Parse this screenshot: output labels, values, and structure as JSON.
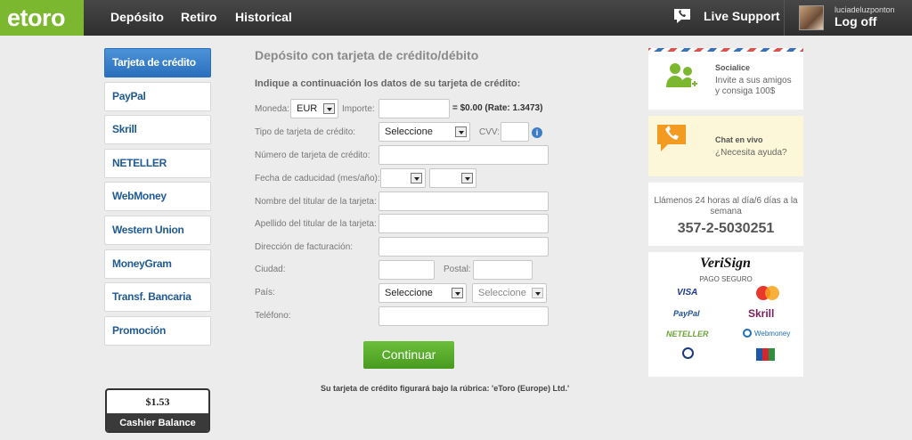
{
  "header": {
    "logo": "etoro",
    "nav": [
      "Depósito",
      "Retiro",
      "Historical"
    ],
    "live_support": "Live Support",
    "username": "luciadeluzponton",
    "logoff": "Log off"
  },
  "sidebar": {
    "items": [
      {
        "label": "Tarjeta de crédito",
        "active": true
      },
      {
        "label": "PayPal"
      },
      {
        "label": "Skrill"
      },
      {
        "label": "NETELLER"
      },
      {
        "label": "WebMoney"
      },
      {
        "label": "Western Union"
      },
      {
        "label": "MoneyGram"
      },
      {
        "label": "Transf. Bancaria"
      },
      {
        "label": "Promoción"
      }
    ],
    "cashier_amount": "$1.53",
    "cashier_label": "Cashier Balance"
  },
  "form": {
    "title": "Depósito con tarjeta de crédito/débito",
    "subtitle": "Indique a continuación los datos de su tarjeta de crédito:",
    "moneda_label": "Moneda:",
    "moneda_value": "EUR",
    "importe_label": "Importe:",
    "importe_value": "",
    "rate_text": "= $0.00 (Rate: 1.3473)",
    "tipo_label": "Tipo de tarjeta de crédito:",
    "tipo_value": "Seleccione",
    "cvv_label": "CVV:",
    "numero_label": "Número de tarjeta de crédito:",
    "fecha_label": "Fecha de caducidad (mes/año):",
    "nombre_label": "Nombre del titular de la tarjeta:",
    "apellido_label": "Apellido del titular de la tarjeta:",
    "direccion_label": "Dirección de facturación:",
    "ciudad_label": "Ciudad:",
    "postal_label": "Postal:",
    "pais_label": "País:",
    "pais_value": "Seleccione",
    "estado_value": "Seleccione",
    "telefono_label": "Teléfono:",
    "submit": "Continuar",
    "note": "Su tarjeta de crédito figurará bajo la rúbrica: 'eToro (Europe) Ltd.'"
  },
  "right": {
    "social_title": "Socialice",
    "social_text": "Invite a sus amigos y consiga 100$",
    "chat_title": "Chat en vivo",
    "chat_text": "¿Necesita ayuda?",
    "call_text": "Llámenos 24 horas al día/6 días a la semana",
    "phone": "357-2-5030251",
    "verisign": "VeriSign",
    "pago_seguro": "PAGO SEGURO",
    "payment_logos": [
      "VISA",
      "MasterCard",
      "PayPal",
      "Skrill",
      "NETELLER",
      "Webmoney",
      "Diners Club",
      "JCB"
    ]
  },
  "colors": {
    "brand_green": "#7cb82f",
    "link_blue": "#1f5a92",
    "button_green": "#5aab2c"
  }
}
